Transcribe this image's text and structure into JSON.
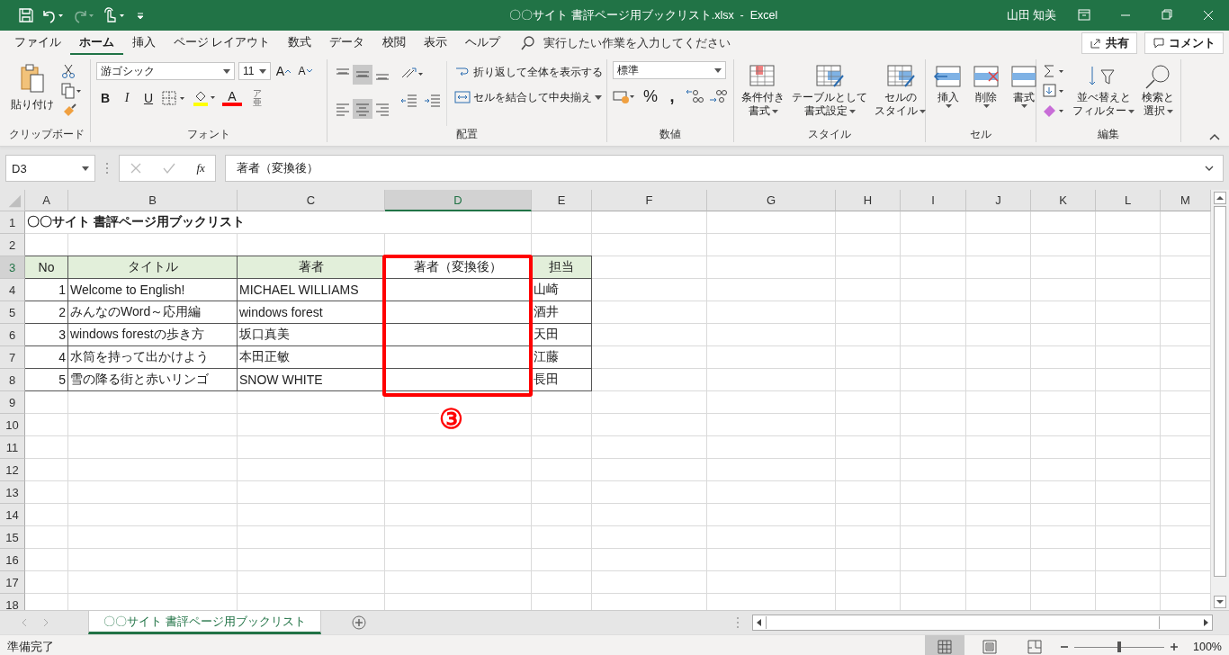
{
  "title_bar": {
    "title": "〇〇サイト 書評ページ用ブックリスト.xlsx  -  Excel",
    "user": "山田 知美",
    "redo_disabled": true
  },
  "menu_tabs": [
    {
      "label": "ファイル",
      "selected": false
    },
    {
      "label": "ホーム",
      "selected": true
    },
    {
      "label": "挿入",
      "selected": false
    },
    {
      "label": "ページ レイアウト",
      "selected": false
    },
    {
      "label": "数式",
      "selected": false
    },
    {
      "label": "データ",
      "selected": false
    },
    {
      "label": "校閲",
      "selected": false
    },
    {
      "label": "表示",
      "selected": false
    },
    {
      "label": "ヘルプ",
      "selected": false
    }
  ],
  "tell_me": {
    "placeholder": "実行したい作業を入力してください"
  },
  "share_button": "共有",
  "comment_button": "コメント",
  "ribbon": {
    "clipboard": {
      "label": "クリップボード",
      "paste": "貼り付け"
    },
    "font": {
      "label": "フォント",
      "name": "游ゴシック",
      "size": "11",
      "grow": "A",
      "shrink": "A",
      "styles": [
        "B",
        "I",
        "U"
      ],
      "color_letter": "A",
      "phonetic": [
        "ア",
        "亜"
      ]
    },
    "alignment": {
      "label": "配置",
      "wrap": "折り返して全体を表示する",
      "merge": "セルを結合して中央揃え",
      "align_buttons": [
        {
          "selected": false
        },
        {
          "selected": true
        },
        {
          "selected": false
        },
        {
          "selected": false
        },
        {
          "selected": true
        },
        {
          "selected": false
        }
      ]
    },
    "number": {
      "label": "数値",
      "format": "標準",
      "percent": "%",
      "comma": ","
    },
    "styles": {
      "label": "スタイル",
      "buttons": [
        {
          "line1": "条件付き",
          "line2": "書式"
        },
        {
          "line1": "テーブルとして",
          "line2": "書式設定"
        },
        {
          "line1": "セルの",
          "line2": "スタイル"
        }
      ]
    },
    "cells": {
      "label": "セル",
      "buttons": [
        "挿入",
        "削除",
        "書式"
      ]
    },
    "editing": {
      "label": "編集",
      "buttons": [
        {
          "line1": "並べ替えと",
          "line2": "フィルター"
        },
        {
          "line1": "検索と",
          "line2": "選択"
        }
      ]
    }
  },
  "formula_bar": {
    "name_box": "D3",
    "fx": "fx",
    "value": "著者（変換後）"
  },
  "columns": [
    {
      "label": "A",
      "selected": false
    },
    {
      "label": "B",
      "selected": false
    },
    {
      "label": "C",
      "selected": false
    },
    {
      "label": "D",
      "selected": true
    },
    {
      "label": "E",
      "selected": false
    },
    {
      "label": "F",
      "selected": false
    },
    {
      "label": "G",
      "selected": false
    },
    {
      "label": "H",
      "selected": false
    },
    {
      "label": "I",
      "selected": false
    },
    {
      "label": "J",
      "selected": false
    },
    {
      "label": "K",
      "selected": false
    },
    {
      "label": "L",
      "selected": false
    },
    {
      "label": "M",
      "selected": false
    }
  ],
  "rows": [
    {
      "num": "1",
      "selected": false,
      "title": "〇〇サイト 書評ページ用ブックリスト"
    },
    {
      "num": "2",
      "selected": false
    },
    {
      "num": "3",
      "selected": true,
      "kind": "header",
      "cells": [
        "No",
        "タイトル",
        "著者",
        "著者（変換後）",
        "担当"
      ]
    },
    {
      "num": "4",
      "selected": false,
      "kind": "data",
      "cells": [
        "1",
        "Welcome to English!",
        "MICHAEL WILLIAMS",
        null,
        "山崎"
      ]
    },
    {
      "num": "5",
      "selected": false,
      "kind": "data",
      "cells": [
        "2",
        "みんなのWord～応用編",
        "windows forest",
        null,
        "酒井"
      ]
    },
    {
      "num": "6",
      "selected": false,
      "kind": "data",
      "cells": [
        "3",
        "windows forestの歩き方",
        "坂口真美",
        null,
        "天田"
      ]
    },
    {
      "num": "7",
      "selected": false,
      "kind": "data",
      "cells": [
        "4",
        "水筒を持って出かけよう",
        "本田正敏",
        null,
        "江藤"
      ]
    },
    {
      "num": "8",
      "selected": false,
      "kind": "data",
      "cells": [
        "5",
        "雪の降る街と赤いリンゴ",
        "SNOW WHITE",
        null,
        "長田"
      ]
    },
    {
      "num": "9",
      "selected": false
    },
    {
      "num": "10",
      "selected": false
    },
    {
      "num": "11",
      "selected": false
    },
    {
      "num": "12",
      "selected": false
    },
    {
      "num": "13",
      "selected": false
    },
    {
      "num": "14",
      "selected": false
    },
    {
      "num": "15",
      "selected": false
    },
    {
      "num": "16",
      "selected": false
    },
    {
      "num": "17",
      "selected": false
    },
    {
      "num": "18",
      "selected": false
    }
  ],
  "callout": {
    "label": "③"
  },
  "sheet_tabs": [
    {
      "label": "〇〇サイト 書評ページ用ブックリスト",
      "selected": true
    }
  ],
  "status": {
    "text": "準備完了",
    "views": [
      {
        "selected": true
      },
      {
        "selected": false
      },
      {
        "selected": false
      }
    ],
    "zoom": {
      "level": 0.5,
      "reading": "100%"
    }
  }
}
